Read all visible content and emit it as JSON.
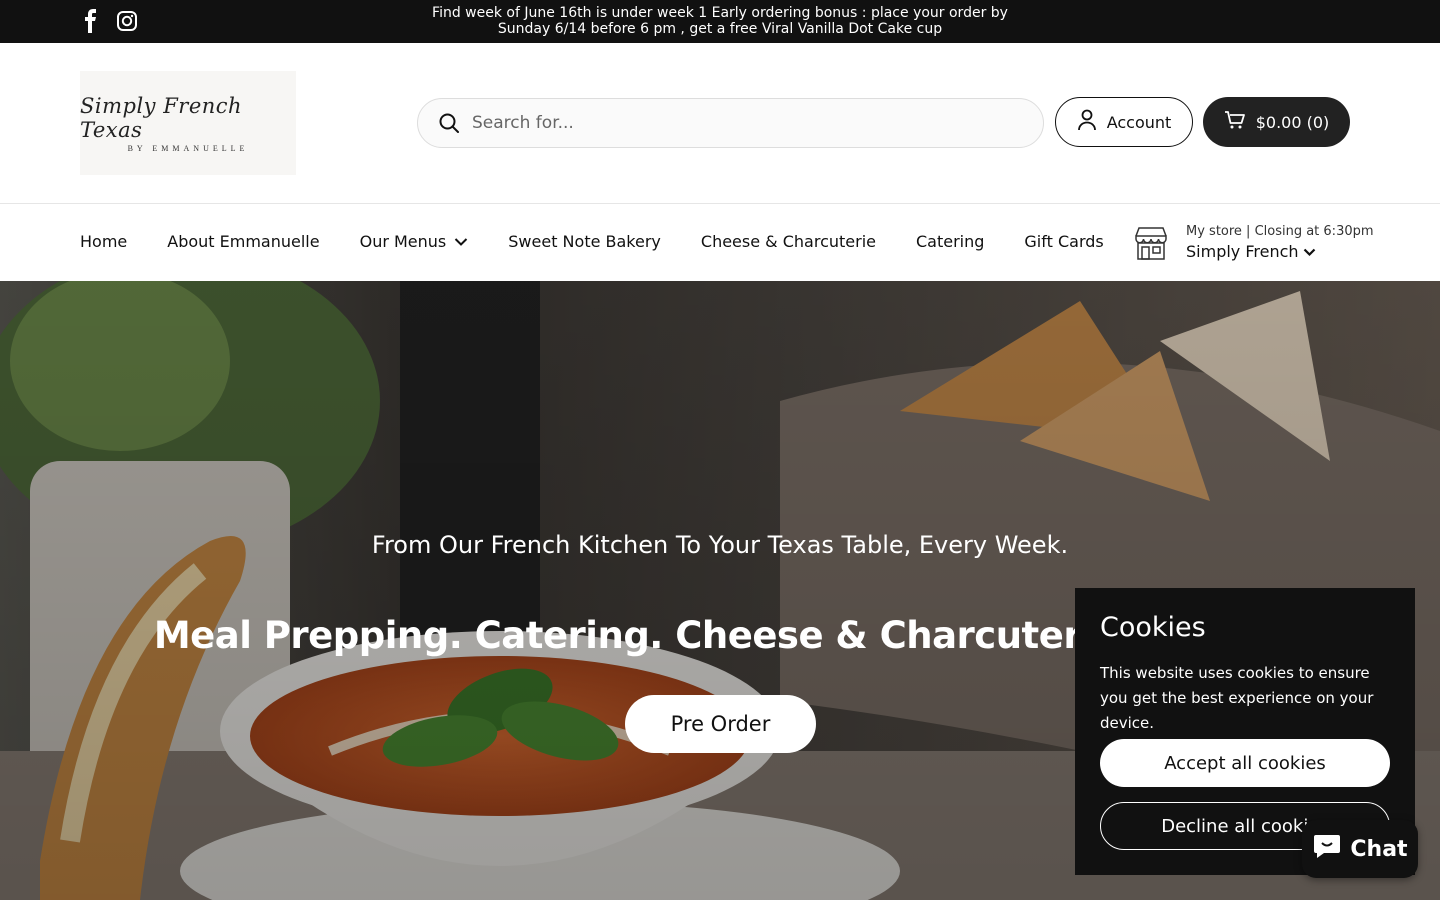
{
  "announcement": {
    "line1": "Find week of June 16th is under week 1 Early ordering bonus : place your order by",
    "line2": "Sunday 6/14 before 6 pm , get a free Viral Vanilla Dot Cake cup"
  },
  "social": {
    "facebook_icon": "facebook-icon",
    "instagram_icon": "instagram-icon"
  },
  "logo": {
    "script": "Simply French Texas",
    "by": "BY EMMANUELLE"
  },
  "search": {
    "placeholder": "Search for..."
  },
  "account": {
    "label": "Account"
  },
  "cart": {
    "label": "$0.00 (0)"
  },
  "nav": {
    "items": [
      "Home",
      "About Emmanuelle",
      "Our Menus",
      "Sweet Note Bakery",
      "Cheese & Charcuterie",
      "Catering",
      "Gift Cards"
    ]
  },
  "store": {
    "meta": "My store  |  Closing at 6:30pm",
    "name": "Simply French"
  },
  "hero": {
    "subheading": "From Our French Kitchen To Your Texas Table, Every Week.",
    "heading": "Meal Prepping. Catering. Cheese & Charcuterie Boards.",
    "cta": "Pre Order"
  },
  "cookies": {
    "title": "Cookies",
    "text": "This website uses cookies to ensure you get the best experience on your device.",
    "accept": "Accept all cookies",
    "decline": "Decline all cookies"
  },
  "chat": {
    "label": "Chat"
  },
  "colors": {
    "dark": "#111111",
    "white": "#ffffff",
    "soup": "#d0602a",
    "basil": "#3d7a2a"
  }
}
